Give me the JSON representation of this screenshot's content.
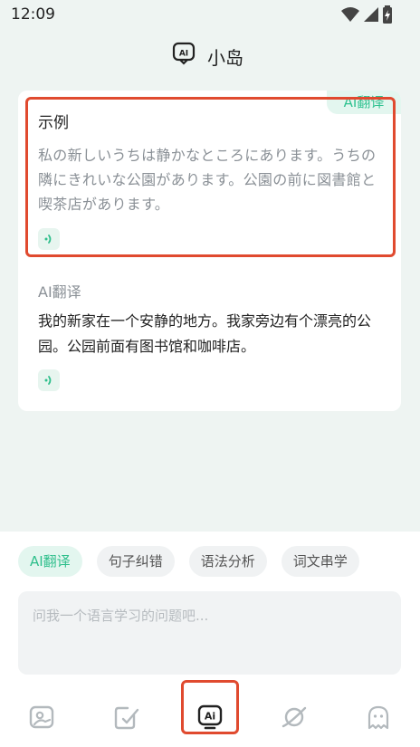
{
  "status_bar": {
    "time": "12:09"
  },
  "header": {
    "title": "小岛"
  },
  "card": {
    "corner_tag": "AI翻译",
    "source_title": "示例",
    "source_text": "私の新しいうちは静かなところにあります。うちの隣にきれいな公園があります。公園の前に図書館と喫茶店があります。",
    "translation_title": "AI翻译",
    "translation_text": "我的新家在一个安静的地方。我家旁边有个漂亮的公园。公园前面有图书馆和咖啡店。"
  },
  "chips": [
    "AI翻译",
    "句子纠错",
    "语法分析",
    "词文串学"
  ],
  "chips_active_index": 0,
  "input": {
    "placeholder": "问我一个语言学习的问题吧..."
  },
  "nav": {
    "items": [
      "photo-icon",
      "check-note-icon",
      "ai-chat-icon",
      "planet-icon",
      "ghost-icon"
    ],
    "active": "ai-chat-icon"
  },
  "colors": {
    "accent": "#2fbf8c",
    "highlight_border": "#e04a2f",
    "page_bg": "#eef4f2"
  }
}
